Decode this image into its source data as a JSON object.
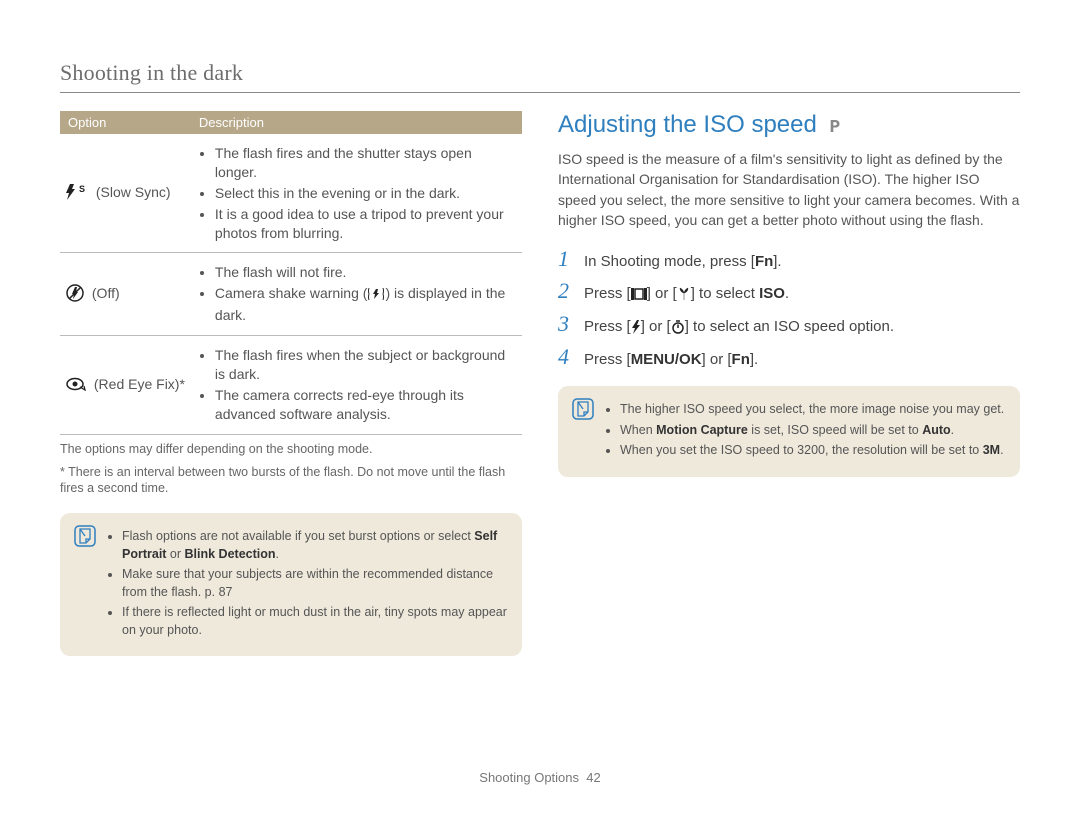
{
  "section_title": "Shooting in the dark",
  "table": {
    "headers": {
      "option": "Option",
      "description": "Description"
    },
    "rows": [
      {
        "icon": "slow-sync-icon",
        "label": "(Slow Sync)",
        "bullets": [
          "The flash fires and the shutter stays open longer.",
          "Select this in the evening or in the dark.",
          "It is a good idea to use a tripod to prevent your photos from blurring."
        ]
      },
      {
        "icon": "flash-off-icon",
        "label": "(Off)",
        "bullets_pre": "The flash will not fire.",
        "bullets_shake_pre": "Camera shake warning (",
        "bullets_shake_post": ") is displayed in the dark."
      },
      {
        "icon": "red-eye-fix-icon",
        "label": "(Red Eye Fix)*",
        "bullets": [
          "The flash fires when the subject or background is dark.",
          "The camera corrects red-eye through its advanced software analysis."
        ]
      }
    ]
  },
  "footnotes": [
    "The options may differ depending on the shooting mode.",
    "* There is an interval between two bursts of the flash. Do not move until the flash fires a second time."
  ],
  "left_note": {
    "item1_pre": "Flash options are not available if you set burst options or select ",
    "item1_b1": "Self Portrait",
    "item1_mid": " or ",
    "item1_b2": "Blink Detection",
    "item1_post": ".",
    "item2": "Make sure that your subjects are within the recommended distance from the flash. p. 87",
    "item3": "If there is reflected light or much dust in the air, tiny spots may appear on your photo."
  },
  "right": {
    "heading": "Adjusting the ISO speed",
    "mode": "P",
    "paragraph": "ISO speed is the measure of a film's sensitivity to light as defined by the International Organisation for Standardisation (ISO). The higher ISO speed you select, the more sensitive to light your camera becomes. With a higher ISO speed, you can get a better photo without using the flash.",
    "steps": {
      "s1_pre": "In Shooting mode, press [",
      "s1_b": "Fn",
      "s1_post": "].",
      "s2_pre": "Press [",
      "s2_mid": "] or [",
      "s2_post": "] to select ",
      "s2_b": "ISO",
      "s2_end": ".",
      "s3_pre": "Press [",
      "s3_mid": "] or [",
      "s3_post": "] to select an ISO speed option.",
      "s4_pre": "Press [",
      "s4_b1": "MENU/OK",
      "s4_mid": "] or [",
      "s4_b2": "Fn",
      "s4_post": "]."
    },
    "note": {
      "item1": "The higher ISO speed you select, the more image noise you may get.",
      "item2_pre": "When ",
      "item2_b1": "Motion Capture",
      "item2_mid": " is set, ISO speed will be set to ",
      "item2_b2": "Auto",
      "item2_post": ".",
      "item3_pre": "When you set the ISO speed to 3200, the resolution will be set to ",
      "item3_b": "3M",
      "item3_post": "."
    }
  },
  "footer": {
    "label": "Shooting Options",
    "page": "42"
  }
}
